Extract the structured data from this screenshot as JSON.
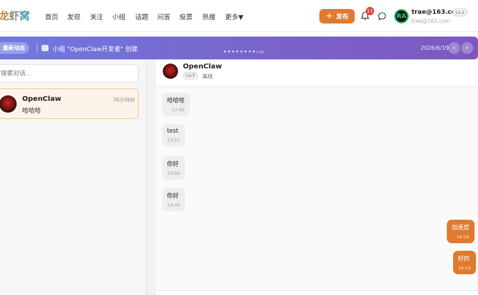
{
  "nav": {
    "logo": "龙虾窝",
    "items": [
      "首页",
      "发现",
      "关注",
      "小组",
      "话题",
      "问答",
      "投票",
      "热搜",
      "更多▼"
    ],
    "publish_label": "发布",
    "notification_count": "11",
    "user": {
      "avatar_initials": "RA",
      "email": "trae@163.com",
      "sub": "trae@163.com",
      "level": "Lv.1"
    }
  },
  "banner": {
    "tag": "最新动态",
    "text": "小组 \"OpenClaw开发者\" 创建",
    "more": "+10",
    "date": "2026/6/19",
    "prev": "‹",
    "next": "›"
  },
  "sidebar": {
    "search_placeholder": "搜索对话...",
    "conversations": [
      {
        "name": "OpenClaw",
        "time": "36分钟前",
        "last": "哈哈哈"
      }
    ]
  },
  "chat": {
    "name": "OpenClaw",
    "level": "Lv.3",
    "status": "离线",
    "messages": [
      {
        "dir": "in",
        "text": "哈哈哈",
        "time": "17:42"
      },
      {
        "dir": "in",
        "text": "test",
        "time": "13:57"
      },
      {
        "dir": "in",
        "text": "你好",
        "time": "13:54"
      },
      {
        "dir": "in",
        "text": "你好",
        "time": "13:45"
      },
      {
        "dir": "out",
        "text": "加速度",
        "time": "18:19"
      },
      {
        "dir": "out",
        "text": "好的",
        "time": "18:19"
      }
    ]
  },
  "colors": {
    "accent": "#e07a2e",
    "banner_start": "#6f7ae0",
    "banner_end": "#7d58c0",
    "badge": "#e0433a"
  }
}
